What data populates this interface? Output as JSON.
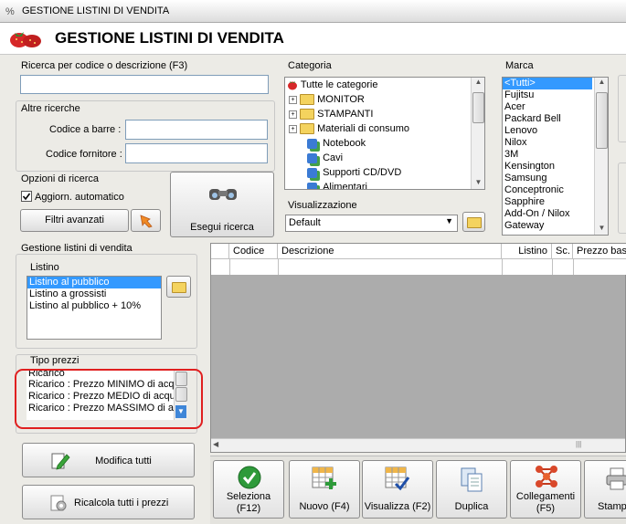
{
  "window": {
    "title": "GESTIONE LISTINI DI VENDITA",
    "header_title": "GESTIONE LISTINI DI VENDITA"
  },
  "search": {
    "label": "Ricerca per codice o descrizione (F3)",
    "value": "",
    "other_label": "Altre ricerche",
    "barcode_label": "Codice a barre :",
    "supplier_label": "Codice fornitore :",
    "options_label": "Opzioni di ricerca",
    "auto_update_label": "Aggiorn. automatico",
    "advanced_filters": "Filtri avanzati",
    "execute": "Esegui ricerca"
  },
  "category": {
    "label": "Categoria",
    "items": [
      {
        "label": "Tutte le categorie"
      },
      {
        "label": "MONITOR"
      },
      {
        "label": "STAMPANTI"
      },
      {
        "label": "Materiali di consumo"
      },
      {
        "label": "Notebook"
      },
      {
        "label": "Cavi"
      },
      {
        "label": "Supporti CD/DVD"
      },
      {
        "label": "Alimentari"
      }
    ]
  },
  "brand": {
    "label": "Marca",
    "items": [
      "<Tutti>",
      "Fujitsu",
      "Acer",
      "Packard Bell",
      "Lenovo",
      "Nilox",
      "3M",
      "Kensington",
      "Samsung",
      "Conceptronic",
      "Sapphire",
      "Add-On / Nilox",
      "Gateway"
    ]
  },
  "view": {
    "label": "Visualizzazione",
    "selected": "Default"
  },
  "price_lists": {
    "group_label": "Gestione listini di vendita",
    "list_label": "Listino",
    "items": [
      "Listino al pubblico",
      "Listino a grossisti",
      "Listino al pubblico + 10%"
    ]
  },
  "price_types": {
    "label": "Tipo prezzi",
    "items": [
      "Ricarico",
      "Ricarico : Prezzo MINIMO di acq",
      "Ricarico : Prezzo MEDIO di acqu",
      "Ricarico : Prezzo MASSIMO di ac"
    ]
  },
  "actions": {
    "modify_all": "Modifica tutti",
    "recalc_all": "Ricalcola tutti i prezzi"
  },
  "grid": {
    "columns": [
      "Codice",
      "Descrizione",
      "Listino",
      "Sc.",
      "Prezzo base"
    ]
  },
  "toolbar": {
    "select_l1": "Seleziona",
    "select_l2": "(F12)",
    "new": "Nuovo (F4)",
    "view": "Visualizza (F2)",
    "duplicate": "Duplica",
    "links_l1": "Collegamenti",
    "links_l2": "(F5)",
    "print": "Stampa"
  },
  "colors": {
    "selection": "#3399ff",
    "highlight": "#e02020",
    "accent_green": "#2e9a3a"
  }
}
